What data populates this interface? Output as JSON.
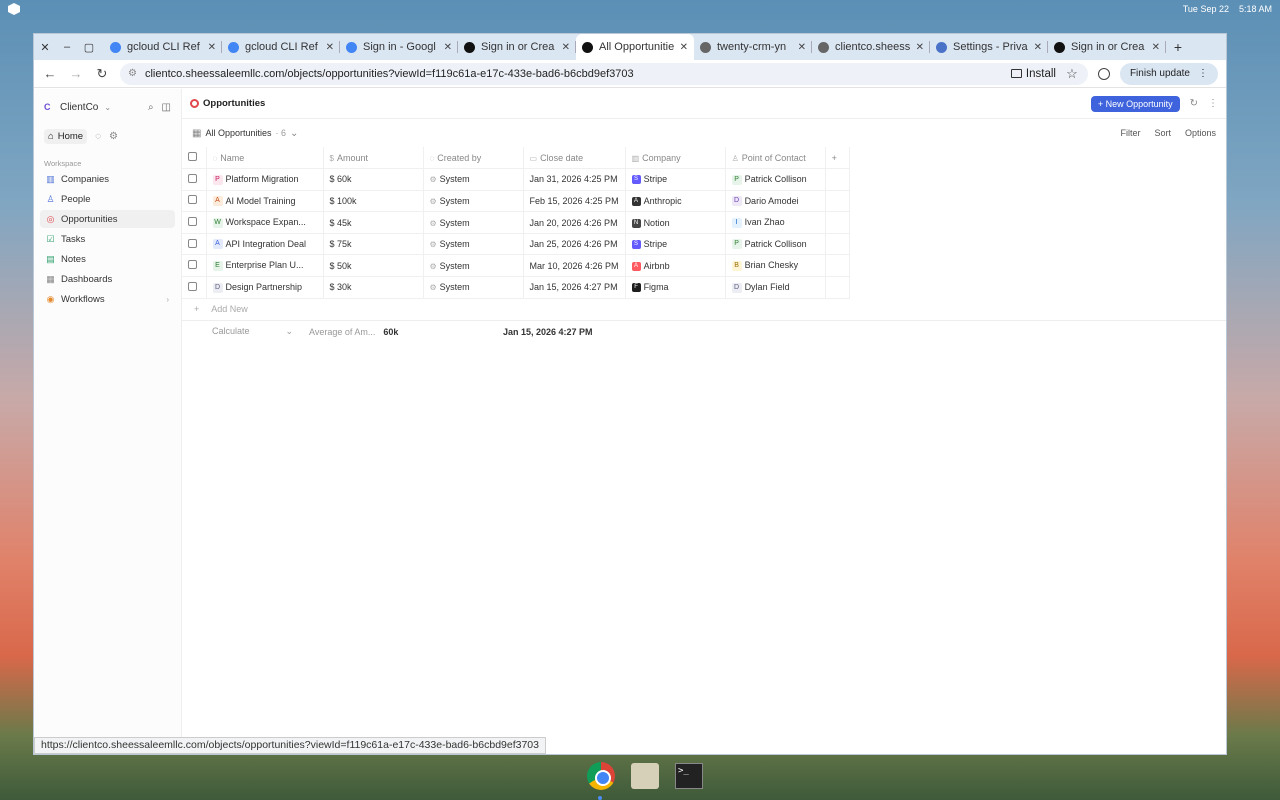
{
  "system": {
    "date": "Tue Sep 22",
    "time": "5:18 AM"
  },
  "browser": {
    "tabs": [
      {
        "label": "gcloud CLI Ref",
        "favicon_color": "#4285f4",
        "favicon_name": "gcloud-icon"
      },
      {
        "label": "gcloud CLI Ref",
        "favicon_color": "#4285f4",
        "favicon_name": "gcloud-icon"
      },
      {
        "label": "Sign in - Googl",
        "favicon_color": "#4285f4",
        "favicon_name": "google-icon"
      },
      {
        "label": "Sign in or Crea",
        "favicon_color": "#111111",
        "favicon_name": "twenty-icon"
      },
      {
        "label": "All Opportunitie",
        "favicon_color": "#111111",
        "favicon_name": "twenty-icon",
        "active": true
      },
      {
        "label": "twenty-crm-yn",
        "favicon_color": "#666666",
        "favicon_name": "globe-icon"
      },
      {
        "label": "clientco.sheess",
        "favicon_color": "#666666",
        "favicon_name": "globe-icon"
      },
      {
        "label": "Settings - Priva",
        "favicon_color": "#4a73c8",
        "favicon_name": "gear-icon"
      },
      {
        "label": "Sign in or Crea",
        "favicon_color": "#111111",
        "favicon_name": "twenty-icon"
      }
    ],
    "url": "clientco.sheessaleemllc.com/objects/opportunities?viewId=f119c61a-e17c-433e-bad6-b6cbd9ef3703",
    "install_label": "Install",
    "finish_update_label": "Finish update",
    "status_url": "https://clientco.sheessaleemllc.com/objects/opportunities?viewId=f119c61a-e17c-433e-bad6-b6cbd9ef3703"
  },
  "sidebar": {
    "workspace_badge": "C",
    "workspace_name": "ClientCo",
    "home_label": "Home",
    "section_label": "Workspace",
    "items": [
      {
        "label": "Companies",
        "icon": "building-icon",
        "color": "#4a6fd6",
        "glyph": "▥"
      },
      {
        "label": "People",
        "icon": "person-icon",
        "color": "#4a6fd6",
        "glyph": "♙"
      },
      {
        "label": "Opportunities",
        "icon": "target-icon",
        "color": "#e0484e",
        "glyph": "◎",
        "active": true
      },
      {
        "label": "Tasks",
        "icon": "checkbox-icon",
        "color": "#2a9d6a",
        "glyph": "☑"
      },
      {
        "label": "Notes",
        "icon": "note-icon",
        "color": "#2a9d6a",
        "glyph": "▤"
      },
      {
        "label": "Dashboards",
        "icon": "dashboard-icon",
        "color": "#888888",
        "glyph": "▦"
      },
      {
        "label": "Workflows",
        "icon": "workflow-icon",
        "color": "#e58a2c",
        "glyph": "◉"
      }
    ]
  },
  "main": {
    "title": "Opportunities",
    "new_button_label": "+ New Opportunity",
    "view_name": "All Opportunities",
    "view_count": "· 6",
    "view_actions": [
      "Filter",
      "Sort",
      "Options"
    ],
    "columns": [
      {
        "label": "Name",
        "icon": "◌"
      },
      {
        "label": "Amount",
        "icon": "$"
      },
      {
        "label": "Created by",
        "icon": "◌"
      },
      {
        "label": "Close date",
        "icon": "▭"
      },
      {
        "label": "Company",
        "icon": "▥"
      },
      {
        "label": "Point of Contact",
        "icon": "♙"
      }
    ],
    "rows": [
      {
        "initial": "P",
        "initial_bg": "#fde7ef",
        "initial_fg": "#c2185b",
        "name": "Platform Migration",
        "amount": "$ 60k",
        "created_by": "System",
        "close_date": "Jan 31, 2026 4:25 PM",
        "company": "Stripe",
        "company_color": "#635bff",
        "company_glyph": "S",
        "contact_initial": "P",
        "contact_bg": "#e6f4ea",
        "contact_fg": "#2e7d32",
        "contact": "Patrick Collison"
      },
      {
        "initial": "A",
        "initial_bg": "#fdebdc",
        "initial_fg": "#c4511b",
        "name": "AI Model Training",
        "amount": "$ 100k",
        "created_by": "System",
        "close_date": "Feb 15, 2026 4:25 PM",
        "company": "Anthropic",
        "company_color": "#333333",
        "company_glyph": "A",
        "contact_initial": "D",
        "contact_bg": "#ede7f6",
        "contact_fg": "#6a3fb5",
        "contact": "Dario Amodei"
      },
      {
        "initial": "W",
        "initial_bg": "#e6f4ea",
        "initial_fg": "#2e7d32",
        "name": "Workspace Expan...",
        "amount": "$ 45k",
        "created_by": "System",
        "close_date": "Jan 20, 2026 4:26 PM",
        "company": "Notion",
        "company_color": "#444444",
        "company_glyph": "N",
        "contact_initial": "I",
        "contact_bg": "#e3f2fd",
        "contact_fg": "#1565c0",
        "contact": "Ivan Zhao"
      },
      {
        "initial": "A",
        "initial_bg": "#e3eafd",
        "initial_fg": "#3e63dd",
        "name": "API Integration Deal",
        "amount": "$ 75k",
        "created_by": "System",
        "close_date": "Jan 25, 2026 4:26 PM",
        "company": "Stripe",
        "company_color": "#635bff",
        "company_glyph": "S",
        "contact_initial": "P",
        "contact_bg": "#e6f4ea",
        "contact_fg": "#2e7d32",
        "contact": "Patrick Collison"
      },
      {
        "initial": "E",
        "initial_bg": "#e6f4ea",
        "initial_fg": "#2e7d32",
        "name": "Enterprise Plan U...",
        "amount": "$ 50k",
        "created_by": "System",
        "close_date": "Mar 10, 2026 4:26 PM",
        "company": "Airbnb",
        "company_color": "#ff5a5f",
        "company_glyph": "A",
        "contact_initial": "B",
        "contact_bg": "#fff4d6",
        "contact_fg": "#9c6b00",
        "contact": "Brian Chesky"
      },
      {
        "initial": "D",
        "initial_bg": "#ececf3",
        "initial_fg": "#5a5a80",
        "name": "Design Partnership",
        "amount": "$ 30k",
        "created_by": "System",
        "close_date": "Jan 15, 2026 4:27 PM",
        "company": "Figma",
        "company_color": "#1e1e1e",
        "company_glyph": "F",
        "contact_initial": "D",
        "contact_bg": "#ececf3",
        "contact_fg": "#5a5a80",
        "contact": "Dylan Field"
      }
    ],
    "add_new_label": "Add New",
    "calculate_label": "Calculate",
    "avg_label": "Average of Am...",
    "avg_value": "60k",
    "calc_date": "Jan 15, 2026 4:27 PM"
  }
}
